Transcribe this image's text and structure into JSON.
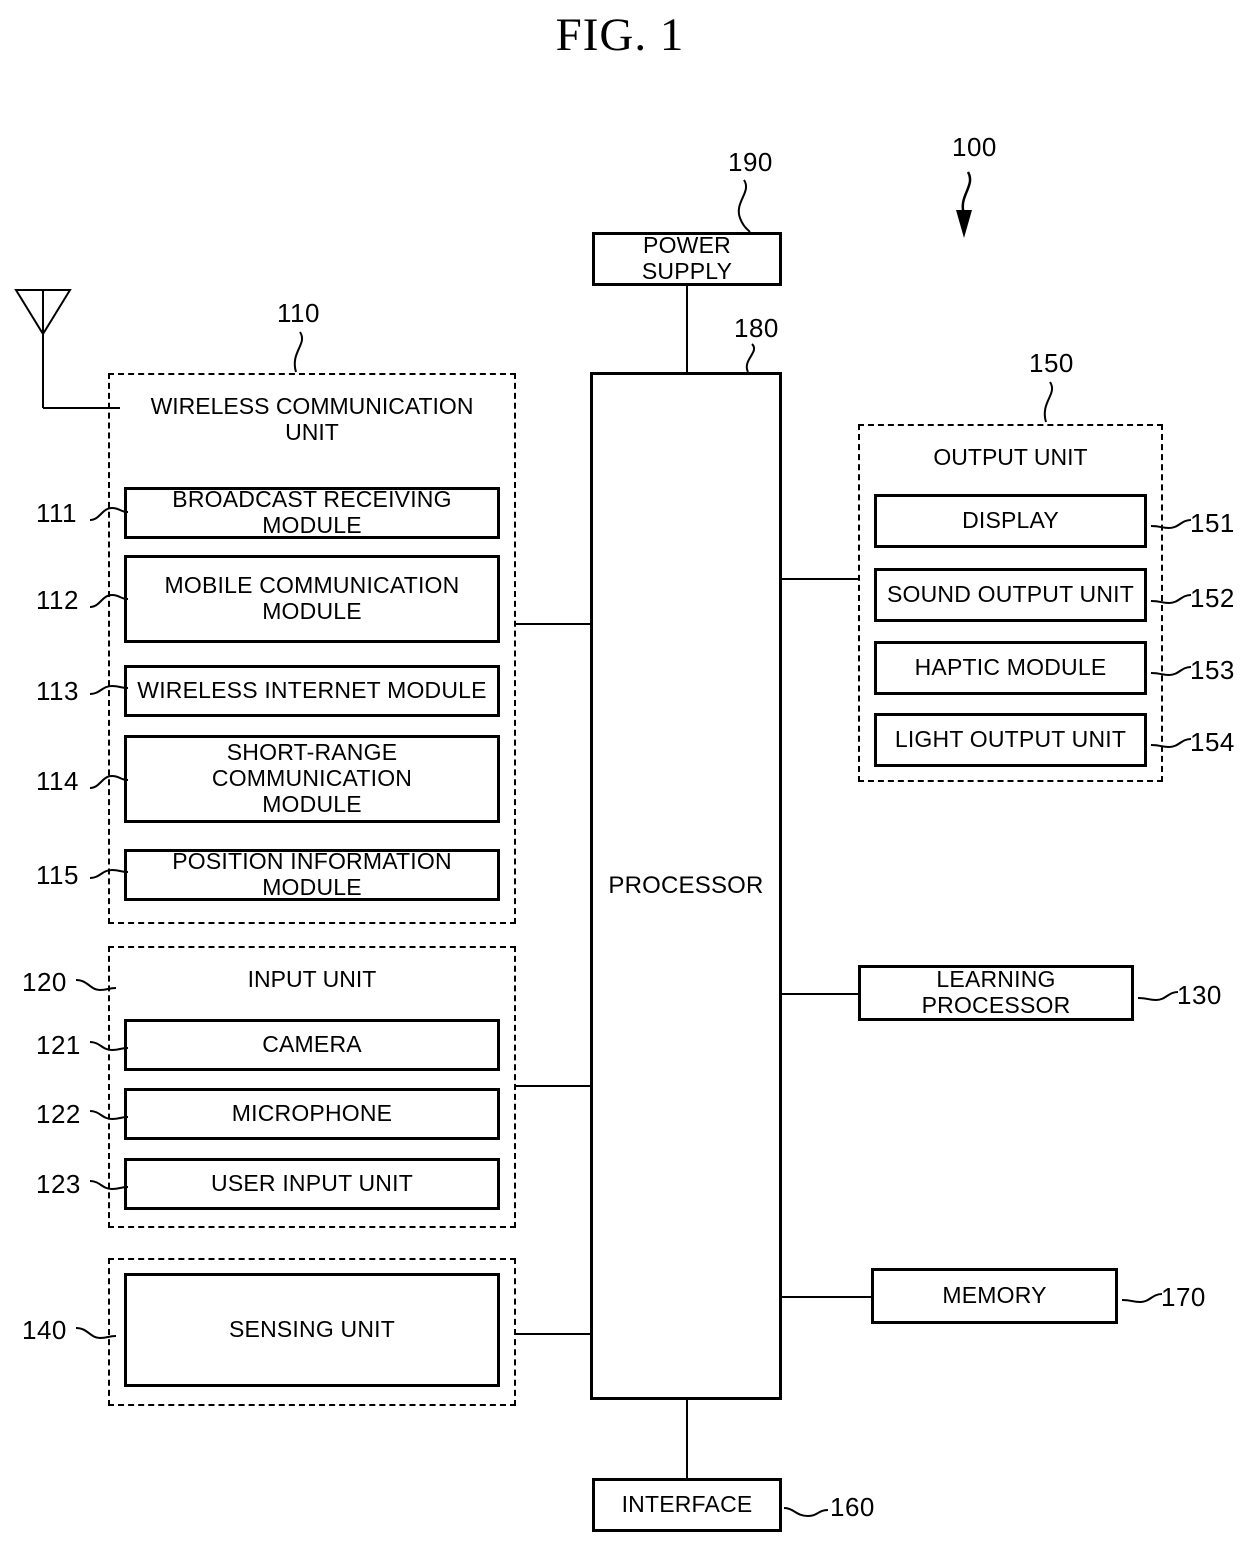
{
  "figure": {
    "title": "FIG. 1",
    "system_ref": "100"
  },
  "power_supply": {
    "label": "POWER SUPPLY",
    "ref": "190"
  },
  "processor": {
    "label": "PROCESSOR",
    "ref": "180"
  },
  "wireless_unit": {
    "title_line1": "WIRELESS COMMUNICATION",
    "title_line2": "UNIT",
    "ref": "110",
    "modules": [
      {
        "label": "BROADCAST RECEIVING MODULE",
        "ref": "111"
      },
      {
        "label": "MOBILE COMMUNICATION\nMODULE",
        "ref": "112"
      },
      {
        "label": "WIRELESS INTERNET MODULE",
        "ref": "113"
      },
      {
        "label": "SHORT-RANGE COMMUNICATION\nMODULE",
        "ref": "114"
      },
      {
        "label": "POSITION INFORMATION MODULE",
        "ref": "115"
      }
    ]
  },
  "input_unit": {
    "title": "INPUT UNIT",
    "ref": "120",
    "modules": [
      {
        "label": "CAMERA",
        "ref": "121"
      },
      {
        "label": "MICROPHONE",
        "ref": "122"
      },
      {
        "label": "USER INPUT UNIT",
        "ref": "123"
      }
    ]
  },
  "sensing_unit": {
    "label": "SENSING UNIT",
    "ref": "140"
  },
  "output_unit": {
    "title": "OUTPUT UNIT",
    "ref": "150",
    "modules": [
      {
        "label": "DISPLAY",
        "ref": "151"
      },
      {
        "label": "SOUND OUTPUT UNIT",
        "ref": "152"
      },
      {
        "label": "HAPTIC MODULE",
        "ref": "153"
      },
      {
        "label": "LIGHT OUTPUT UNIT",
        "ref": "154"
      }
    ]
  },
  "learning_processor": {
    "label": "LEARNING PROCESSOR",
    "ref": "130"
  },
  "memory": {
    "label": "MEMORY",
    "ref": "170"
  },
  "interface": {
    "label": "INTERFACE",
    "ref": "160"
  },
  "icons": {
    "antenna": "antenna-icon",
    "system_arrow": "system-pointer-arrow-icon"
  }
}
